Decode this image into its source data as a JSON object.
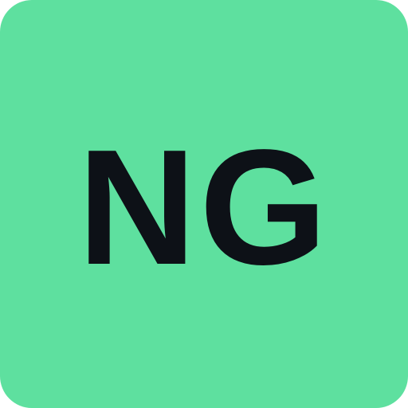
{
  "avatar": {
    "initials": "NG",
    "background_color": "#5EE09F",
    "text_color": "#0D1117"
  }
}
